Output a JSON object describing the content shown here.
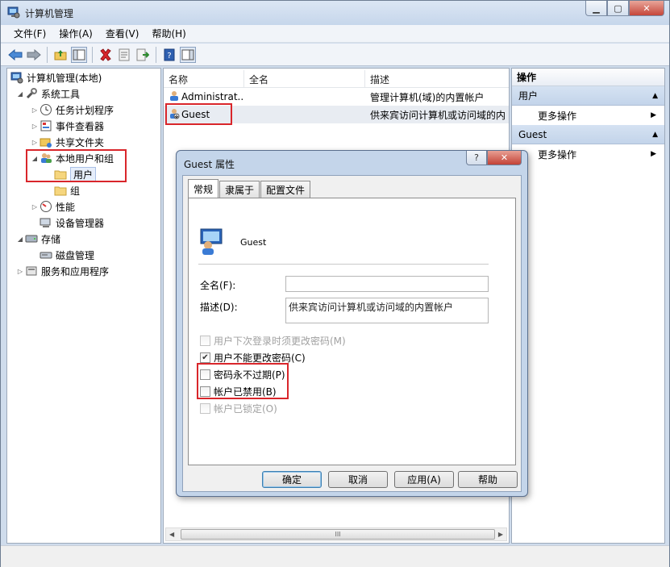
{
  "window": {
    "title": "计算机管理"
  },
  "menubar": [
    {
      "label": "文件(F)"
    },
    {
      "label": "操作(A)"
    },
    {
      "label": "查看(V)"
    },
    {
      "label": "帮助(H)"
    }
  ],
  "tree": {
    "root": "计算机管理(本地)",
    "items": [
      {
        "label": "系统工具"
      },
      {
        "label": "任务计划程序"
      },
      {
        "label": "事件查看器"
      },
      {
        "label": "共享文件夹"
      },
      {
        "label": "本地用户和组"
      },
      {
        "label": "用户"
      },
      {
        "label": "组"
      },
      {
        "label": "性能"
      },
      {
        "label": "设备管理器"
      },
      {
        "label": "存储"
      },
      {
        "label": "磁盘管理"
      },
      {
        "label": "服务和应用程序"
      }
    ]
  },
  "list": {
    "columns": [
      "名称",
      "全名",
      "描述"
    ],
    "rows": [
      {
        "name": "Administrat...",
        "fullname": "",
        "description": "管理计算机(域)的内置帐户"
      },
      {
        "name": "Guest",
        "fullname": "",
        "description": "供来宾访问计算机或访问域的内"
      }
    ],
    "scroll_grip": "III"
  },
  "actions": {
    "header": "操作",
    "sections": [
      {
        "title": "用户",
        "item": "更多操作"
      },
      {
        "title": "Guest",
        "item": "更多操作"
      }
    ]
  },
  "dialog": {
    "title": "Guest 属性",
    "help_glyph": "?",
    "close_glyph": "✕",
    "tabs": [
      "常规",
      "隶属于",
      "配置文件"
    ],
    "active_tab": 0,
    "user_name": "Guest",
    "fullname_label": "全名(F):",
    "fullname_value": "",
    "description_label": "描述(D):",
    "description_value": "供来宾访问计算机或访问域的内置帐户",
    "checkboxes": [
      {
        "label": "用户下次登录时须更改密码(M)",
        "checked": false,
        "disabled": true
      },
      {
        "label": "用户不能更改密码(C)",
        "checked": true,
        "disabled": false
      },
      {
        "label": "密码永不过期(P)",
        "checked": false,
        "disabled": false
      },
      {
        "label": "帐户已禁用(B)",
        "checked": false,
        "disabled": false
      },
      {
        "label": "帐户已锁定(O)",
        "checked": false,
        "disabled": true
      }
    ],
    "buttons": {
      "ok": "确定",
      "cancel": "取消",
      "apply": "应用(A)",
      "help": "帮助"
    }
  },
  "colors": {
    "highlight_red": "#d9262b",
    "accent_blue": "#3c7fb1"
  }
}
